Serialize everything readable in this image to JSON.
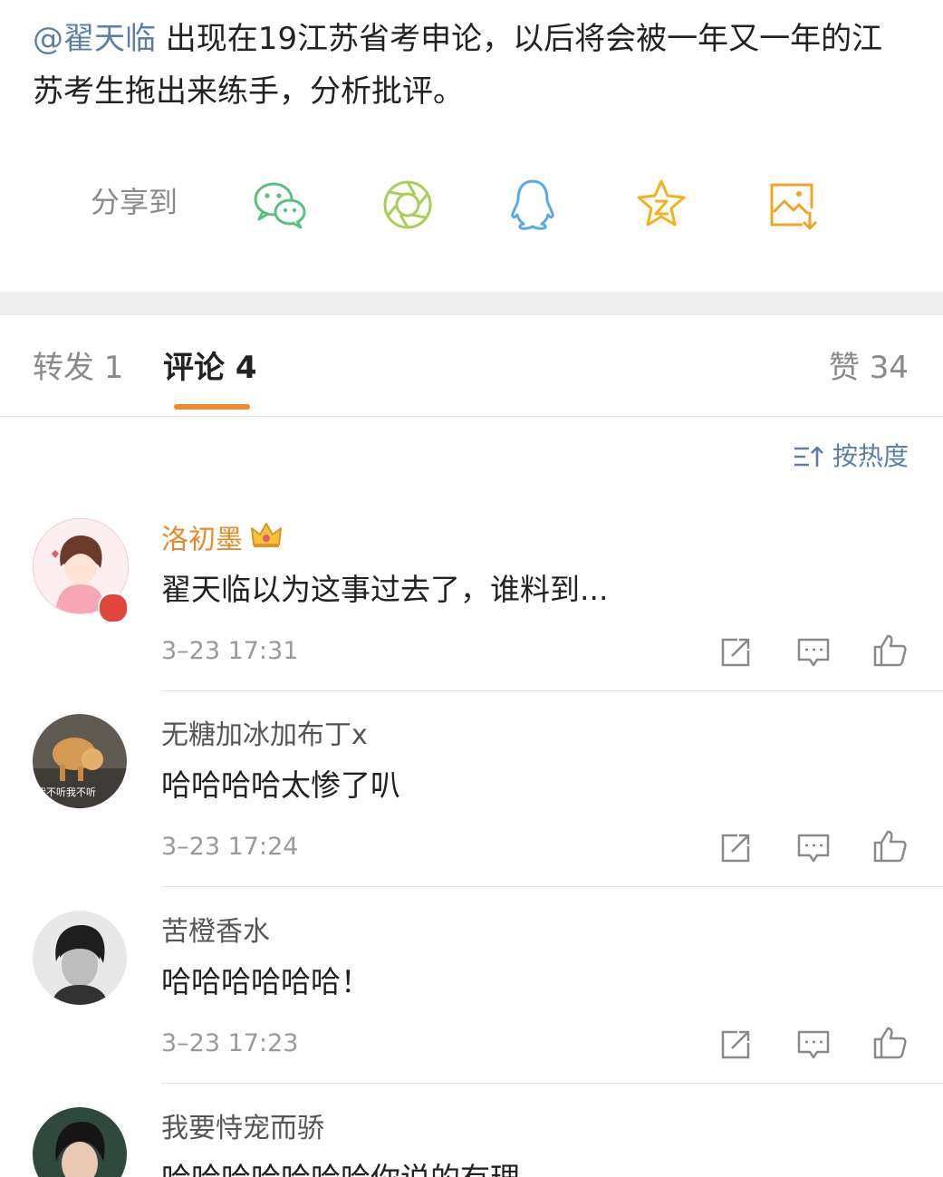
{
  "post": {
    "mention": "@翟天临",
    "text": " 出现在19江苏省考申论，以后将会被一年又一年的江苏考生拖出来练手，分析批评。"
  },
  "share": {
    "label": "分享到",
    "icons": [
      "wechat-icon",
      "moments-icon",
      "qq-icon",
      "qzone-icon",
      "save-image-icon"
    ],
    "colors": {
      "green": "#5ac07a",
      "lightgreen": "#a7cf58",
      "blue": "#5aa8e6",
      "yellow": "#f2b21c",
      "orange": "#f0a623"
    }
  },
  "tabs": {
    "repost": "转发 1",
    "comment": "评论 4",
    "like": "赞 34",
    "accent": "#f08a2c"
  },
  "sort": {
    "label": "按热度",
    "color": "#5b7fa8"
  },
  "comments": [
    {
      "name": "洛初墨",
      "text": "翟天临以为这事过去了，谁料到...",
      "time": "3–23 17:31",
      "vip": true
    },
    {
      "name": "无糖加冰加布丁x",
      "text": "哈哈哈哈太惨了叭",
      "time": "3–23 17:24",
      "avatar_caption": "我不听我不听"
    },
    {
      "name": "苦橙香水",
      "text": "哈哈哈哈哈哈！",
      "time": "3–23 17:23"
    },
    {
      "name": "我要恃宠而骄",
      "text": "哈哈哈哈哈哈哈你说的有理"
    }
  ]
}
